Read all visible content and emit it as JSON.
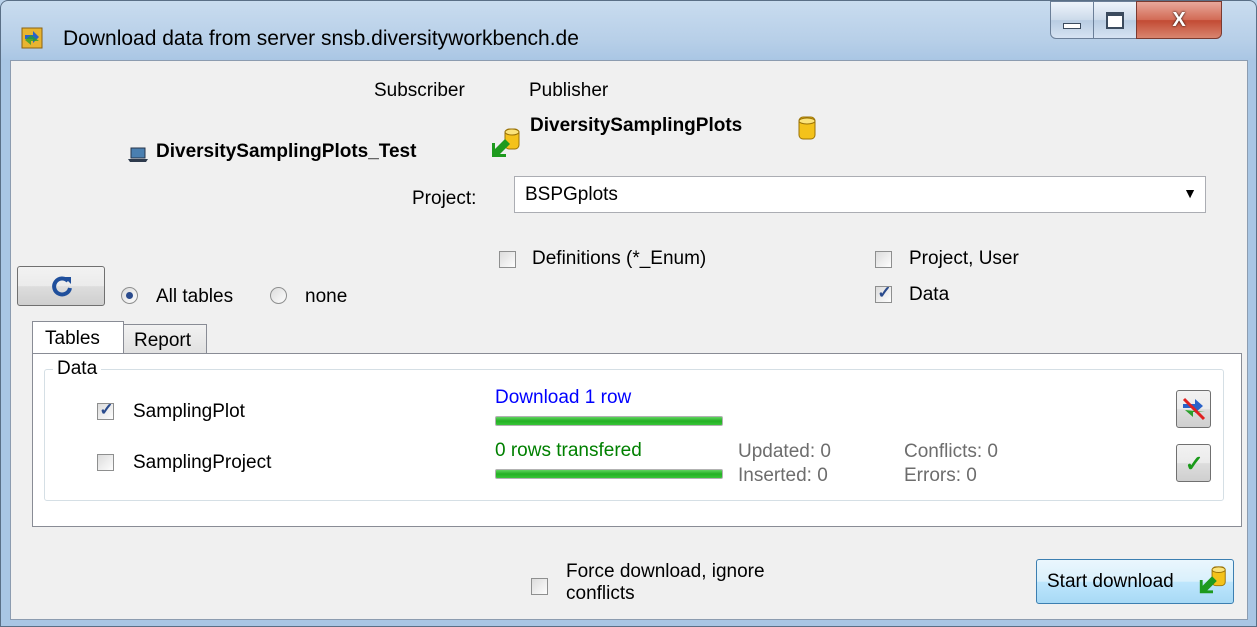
{
  "window": {
    "title": "Download data from server snsb.diversityworkbench.de",
    "controls": {
      "minimize": "minimize-icon",
      "maximize": "maximize-icon",
      "close": "X"
    }
  },
  "header": {
    "subscriber_label": "Subscriber",
    "publisher_label": "Publisher",
    "subscriber_db": "DiversitySamplingPlots_Test",
    "publisher_db": "DiversitySamplingPlots"
  },
  "project": {
    "label": "Project:",
    "value": "BSPGplots"
  },
  "options": {
    "definitions": {
      "label": "Definitions (*_Enum)",
      "checked": false
    },
    "project_user": {
      "label": "Project, User",
      "checked": false
    },
    "data": {
      "label": "Data",
      "checked": true
    }
  },
  "selection": {
    "refresh_icon": "refresh-icon",
    "all_tables": {
      "label": "All tables",
      "selected": true
    },
    "none": {
      "label": "none",
      "selected": false
    }
  },
  "tabs": [
    {
      "label": "Tables",
      "active": true
    },
    {
      "label": "Report",
      "active": false
    }
  ],
  "group": {
    "title": "Data",
    "tables": [
      {
        "name": "SamplingPlot",
        "checked": true
      },
      {
        "name": "SamplingProject",
        "checked": false
      }
    ],
    "download_status": "Download 1 row",
    "transfer_status": "0 rows transfered",
    "updated": "Updated: 0",
    "inserted": "Inserted: 0",
    "conflicts": "Conflicts: 0",
    "errors": "Errors: 0",
    "progress_download": 1.0,
    "progress_transfer": 1.0
  },
  "footer": {
    "force_line1": "Force download, ignore",
    "force_line2": "conflicts",
    "force_checked": false,
    "start_label": "Start download"
  },
  "colors": {
    "accent_blue": "#0000ff",
    "accent_green": "#008000",
    "progress": "#24b024"
  }
}
